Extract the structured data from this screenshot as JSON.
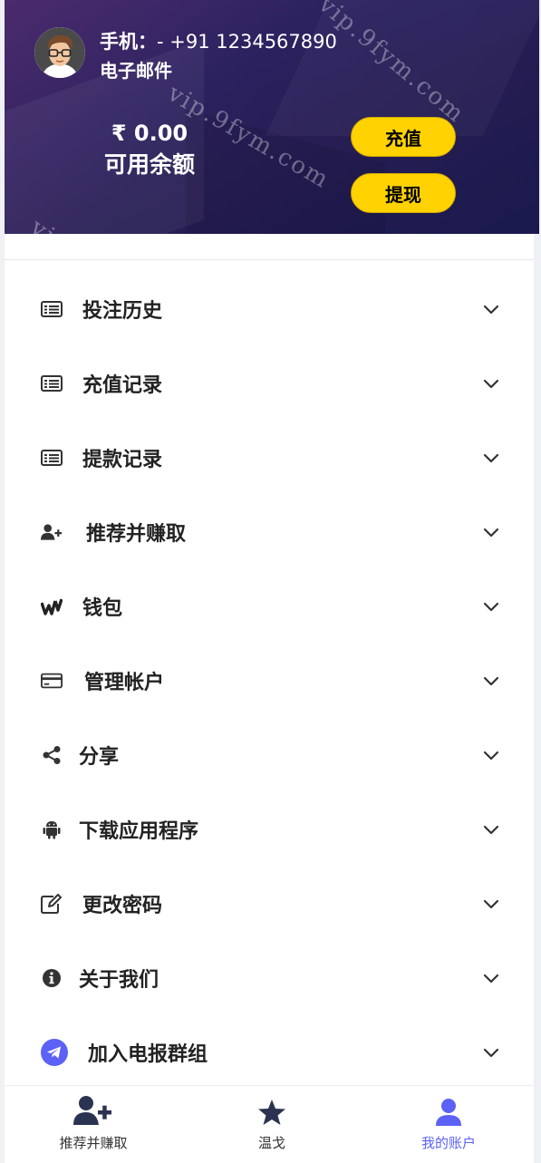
{
  "header": {
    "phone_label": "手机：",
    "phone_value": "- +91 1234567890",
    "email_label": "电子邮件",
    "balance_amount": "₹ 0.00",
    "balance_label": "可用余额",
    "recharge_label": "充值",
    "withdraw_label": "提现",
    "watermark": "vip.9fym.com"
  },
  "menu": {
    "items": [
      {
        "label": "投注历史",
        "icon": "list-icon"
      },
      {
        "label": "充值记录",
        "icon": "list-icon"
      },
      {
        "label": "提款记录",
        "icon": "list-icon"
      },
      {
        "label": "推荐并赚取",
        "icon": "user-plus-icon"
      },
      {
        "label": "钱包",
        "icon": "wallet-icon"
      },
      {
        "label": "管理帐户",
        "icon": "credit-card-icon"
      },
      {
        "label": "分享",
        "icon": "share-icon"
      },
      {
        "label": "下载应用程序",
        "icon": "android-icon"
      },
      {
        "label": "更改密码",
        "icon": "edit-icon"
      },
      {
        "label": "关于我们",
        "icon": "info-icon"
      },
      {
        "label": "加入电报群组",
        "icon": "telegram-icon"
      }
    ]
  },
  "bottom_nav": {
    "refer_label": "推荐并赚取",
    "game_label": "温戈",
    "account_label": "我的账户"
  },
  "colors": {
    "accent_yellow": "#ffd200",
    "active_nav": "#5b62f5",
    "telegram": "#5b62f5"
  }
}
